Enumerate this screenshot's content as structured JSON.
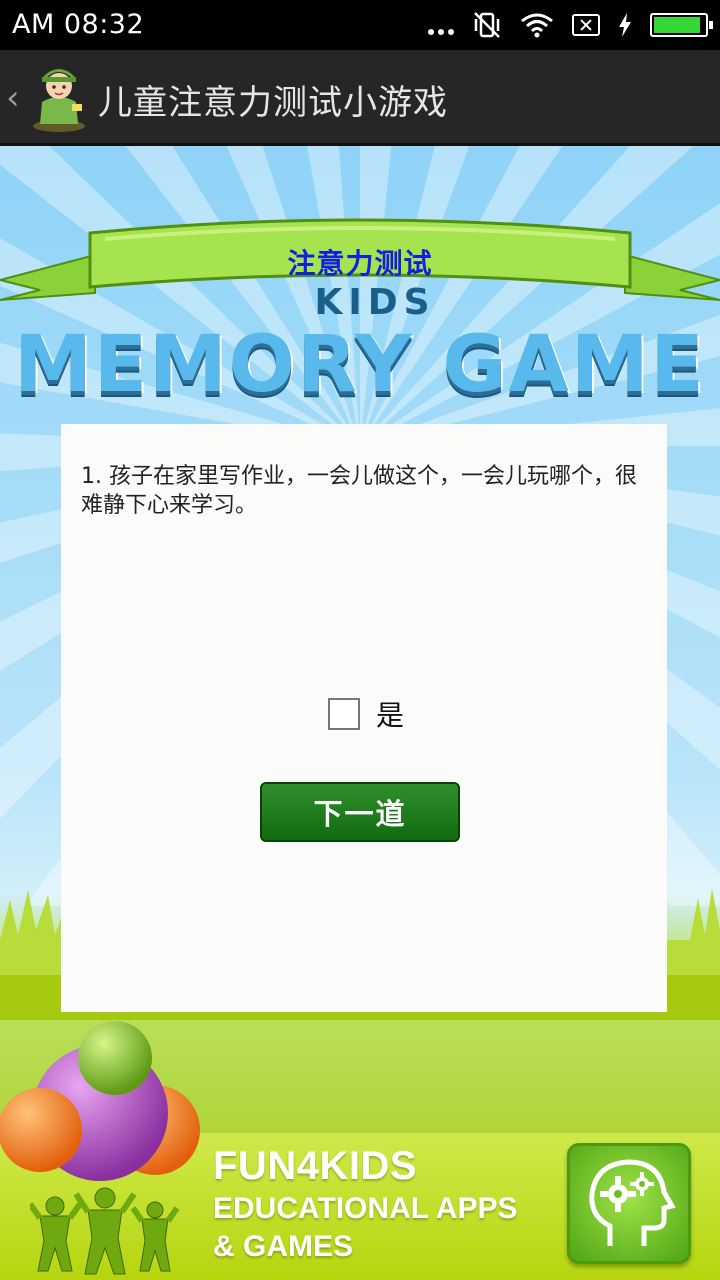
{
  "status_bar": {
    "time": "AM 08:32"
  },
  "action_bar": {
    "title": "儿童注意力测试小游戏"
  },
  "banner": {
    "title": "注意力测试"
  },
  "logo": {
    "subtitle": "KIDS",
    "title": "MEMORY GAME"
  },
  "quiz": {
    "question": "1. 孩子在家里写作业，一会儿做这个，一会儿玩哪个，很难静下心来学习。",
    "answer_label": "是",
    "answer_checked": false,
    "next_label": "下一道"
  },
  "promo": {
    "line1": "FUN4KIDS",
    "line2": "EDUCATIONAL APPS",
    "line3": "& GAMES"
  },
  "colors": {
    "action_bar": "#262626",
    "banner_text": "#1020e0",
    "button": "#1a7a16",
    "logo": "#5ab9ec",
    "promo": "#c4df2a"
  }
}
